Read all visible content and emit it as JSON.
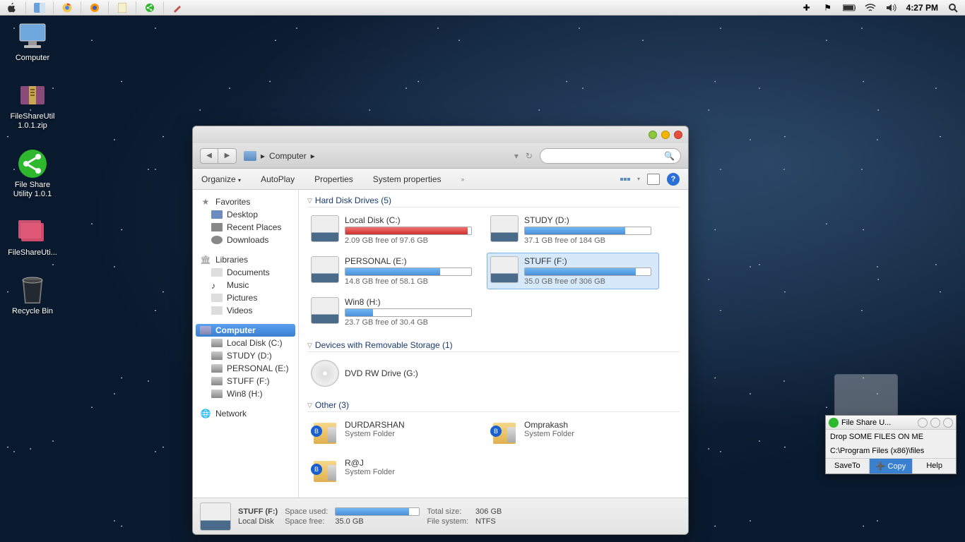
{
  "menubar": {
    "time": "4:27 PM"
  },
  "desktop": {
    "icons": [
      {
        "label": "Computer"
      },
      {
        "label": "FileShareUtil 1.0.1.zip"
      },
      {
        "label": "File Share Utility 1.0.1"
      },
      {
        "label": "FileShareUti..."
      },
      {
        "label": "Recycle Bin"
      }
    ]
  },
  "explorer": {
    "breadcrumb": "Computer",
    "toolbar": {
      "organize": "Organize",
      "autoplay": "AutoPlay",
      "properties": "Properties",
      "system_properties": "System properties"
    },
    "sidebar": {
      "favorites": {
        "head": "Favorites",
        "items": [
          "Desktop",
          "Recent Places",
          "Downloads"
        ]
      },
      "libraries": {
        "head": "Libraries",
        "items": [
          "Documents",
          "Music",
          "Pictures",
          "Videos"
        ]
      },
      "computer": {
        "head": "Computer",
        "items": [
          "Local Disk (C:)",
          "STUDY (D:)",
          "PERSONAL (E:)",
          "STUFF (F:)",
          "Win8 (H:)"
        ]
      },
      "network": {
        "head": "Network"
      }
    },
    "sections": {
      "hdd_head": "Hard Disk Drives (5)",
      "removable_head": "Devices with Removable Storage (1)",
      "other_head": "Other (3)"
    },
    "drives": [
      {
        "name": "Local Disk (C:)",
        "free": "2.09 GB free of 97.6 GB",
        "pct": 97,
        "red": true
      },
      {
        "name": "STUDY (D:)",
        "free": "37.1 GB free of 184 GB",
        "pct": 80
      },
      {
        "name": "PERSONAL (E:)",
        "free": "14.8 GB free of 58.1 GB",
        "pct": 75
      },
      {
        "name": "STUFF (F:)",
        "free": "35.0 GB free of 306 GB",
        "pct": 88,
        "selected": true
      },
      {
        "name": "Win8 (H:)",
        "free": "23.7 GB free of 30.4 GB",
        "pct": 22
      }
    ],
    "removable": [
      {
        "name": "DVD RW Drive (G:)"
      }
    ],
    "other": [
      {
        "name": "DURDARSHAN",
        "sub": "System Folder"
      },
      {
        "name": "Omprakash",
        "sub": "System Folder"
      },
      {
        "name": "R@J",
        "sub": "System Folder"
      }
    ],
    "status": {
      "name": "STUFF (F:)",
      "type": "Local Disk",
      "space_used_label": "Space used:",
      "space_free_label": "Space free:",
      "space_free": "35.0 GB",
      "total_label": "Total size:",
      "total": "306 GB",
      "fs_label": "File system:",
      "fs": "NTFS"
    }
  },
  "utilwin": {
    "title": "File Share U...",
    "line1": "Drop SOME FILES ON ME",
    "line2": "C:\\Program Files (x86)\\files",
    "btn_saveto": "SaveTo",
    "btn_copy": "Copy",
    "btn_help": "Help"
  }
}
